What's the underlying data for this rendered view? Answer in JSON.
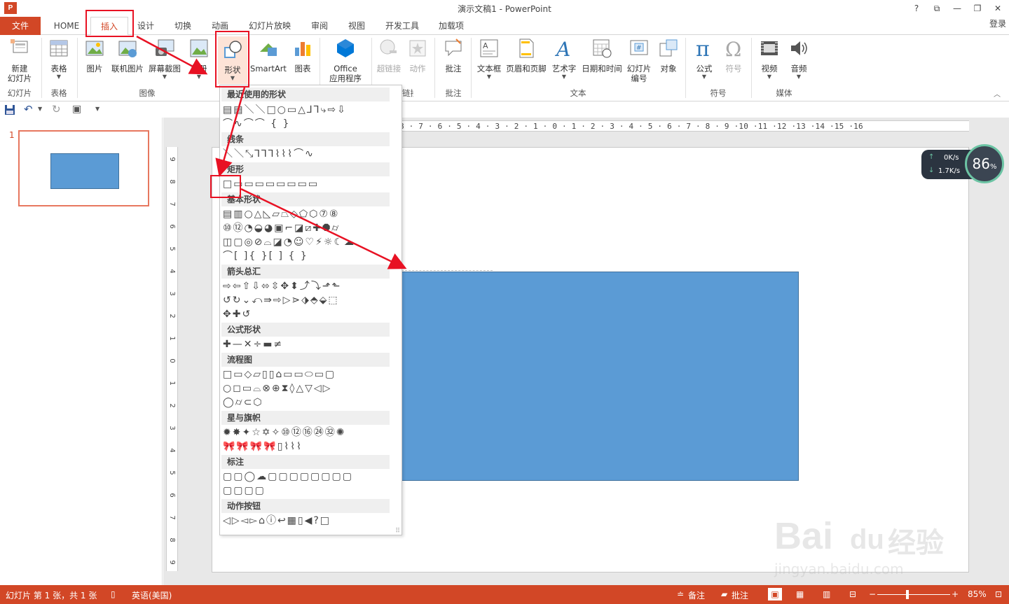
{
  "titlebar": {
    "app_icon": "P",
    "title": "演示文稿1 - PowerPoint",
    "help": "?",
    "ribbon_display": "⧉",
    "minimize": "—",
    "restore": "❐",
    "close": "✕"
  },
  "tabs": [
    "文件",
    "HOME",
    "插入",
    "设计",
    "切换",
    "动画",
    "幻灯片放映",
    "审阅",
    "视图",
    "开发工具",
    "加载项"
  ],
  "login": "登录",
  "ribbon": {
    "new_slide": "新建\n幻灯片",
    "group_slides": "幻灯片",
    "table": "表格",
    "group_table": "表格",
    "picture": "图片",
    "online_picture": "联机图片",
    "screenshot": "屏幕截图",
    "album": "相册",
    "group_images": "图像",
    "shapes": "形状",
    "smartart": "SmartArt",
    "chart": "图表",
    "office_apps": "Office\n应用程序",
    "hyperlink": "超链接",
    "action": "动作",
    "group_links": "链接",
    "comment": "批注",
    "group_comments": "批注",
    "textbox": "文本框",
    "header_footer": "页眉和页脚",
    "wordart": "艺术字",
    "datetime": "日期和时间",
    "slide_number": "幻灯片\n编号",
    "object": "对象",
    "group_text": "文本",
    "equation": "公式",
    "symbol": "符号",
    "group_symbols": "符号",
    "video": "视频",
    "audio": "音频",
    "group_media": "媒体"
  },
  "thumbnails": {
    "slide_number": "1"
  },
  "ruler": {
    "h_text": "8 · 7 · 6 · 5 · 4 · 3 · 2 · 1 · 0 · 1 · 2 · 3 · 4 · 5 · 6 · 7 · 8 · 9 ·10 ·11 ·12 ·13 ·14 ·15 ·16",
    "v_labels": [
      "9",
      "8",
      "7",
      "6",
      "5",
      "4",
      "3",
      "2",
      "1",
      "0",
      "1",
      "2",
      "3",
      "4",
      "5",
      "6",
      "7",
      "8",
      "9"
    ]
  },
  "net_monitor": {
    "upload": "0K/s",
    "download": "1.7K/s",
    "percent": "86",
    "percent_sign": "%"
  },
  "shapes_menu": {
    "recent": "最近使用的形状",
    "lines": "线条",
    "rectangles": "矩形",
    "basic": "基本形状",
    "arrows": "箭头总汇",
    "equation": "公式形状",
    "flowchart": "流程图",
    "stars": "星与旗帜",
    "callouts": "标注",
    "action_buttons": "动作按钮",
    "rows": {
      "recent1": "▤▤＼＼□○▭△⅃⅂⤷⇨⇩",
      "recent2": "⌒∿⌒⌒ {   }",
      "lines1": "＼＼⤡⅂⅂⅂⌇⌇⌇⌒∿",
      "rect1": "□▭▭▭▭▭▭▭▭",
      "basic1": "▤▥○△◺▱⏢◇⬠⬡⑦⑧",
      "basic2": "⑩⑫◔◒◕▣⌐◪⧄✚⯃⌭",
      "basic3": "◫▢◎⊘⌓◪◔☺♡⚡☼☾☁",
      "basic4": "⌒[ ]{ }[  ]  {   }",
      "arrows1": "⇨⇦⇧⇩⬄⇳✥⬍⤴⤵⬏⬑",
      "arrows2": "↺↻⌄⤺⇛⇨▷⋗⬗⬘⬙⬚",
      "arrows3": "✥✚↺",
      "equation1": "✚—✕÷▬≠",
      "flow1": "□▭◇▱▯▯⌂▭▭⬭▭▢",
      "flow2": "○◻▭⌓⊗⊕⧗◊△▽◁▷",
      "flow3": "◯⌭⊂⬡",
      "stars1": "✹✸✦☆✡✧⑩⑫⑯㉔㉜✺",
      "stars2": "🎀🎀🎀🎀▯⌇⌇⌇",
      "callouts1": "▢▢◯☁▢▢▢▢▢▢▢▢",
      "callouts2": "▢▢▢▢",
      "action1": "◁▷◅▻⌂ⓘ↩▦▯◀?□"
    }
  },
  "statusbar": {
    "slide_info": "幻灯片 第 1 张，共 1 张",
    "language": "英语(美国)",
    "notes": "备注",
    "comments": "批注",
    "zoom": "85%"
  },
  "watermark": {
    "logo": "Bai",
    "logo2": "du",
    "logo3": "经验",
    "url": "jingyan.baidu.com"
  },
  "colors": {
    "accent": "#d24726",
    "shape_fill": "#5b9bd5",
    "highlight": "#e81123"
  }
}
